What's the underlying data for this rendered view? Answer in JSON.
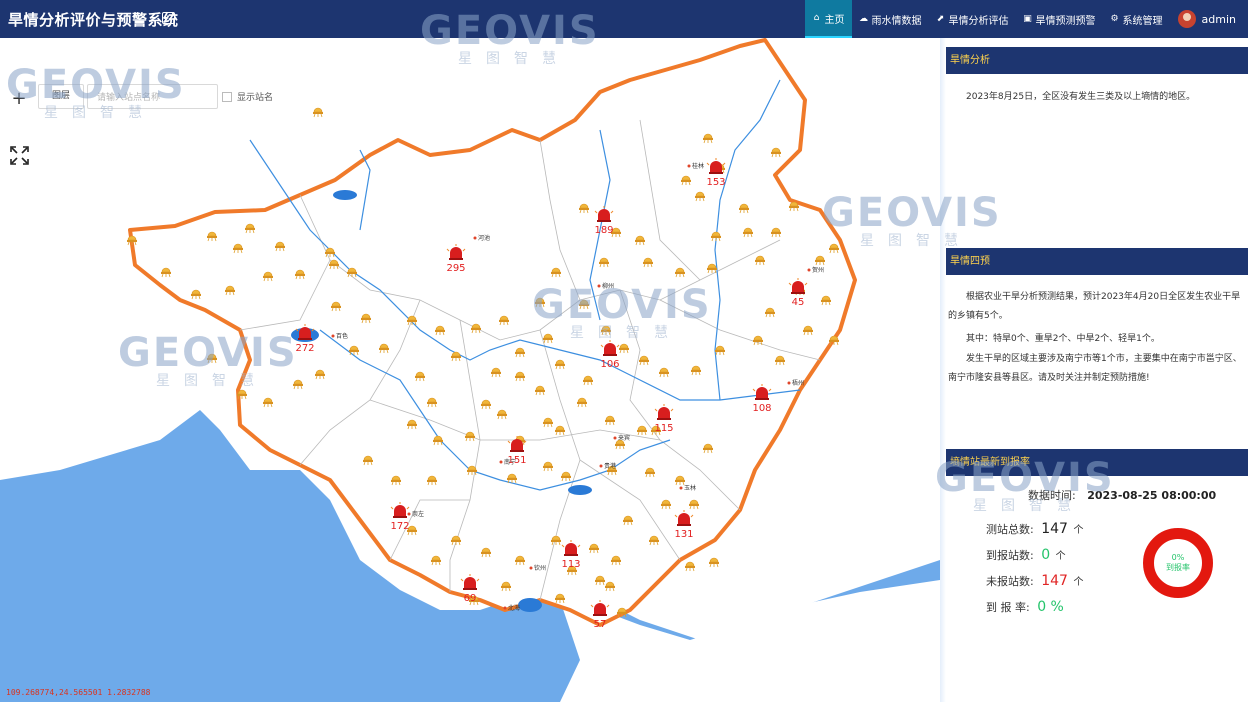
{
  "header": {
    "title": "旱情分析评价与预警系统",
    "nav": [
      {
        "label": "主页",
        "icon": "home-icon",
        "glyph": "⌂",
        "active": true
      },
      {
        "label": "雨水情数据",
        "icon": "rain-cloud-icon",
        "glyph": "☁",
        "active": false
      },
      {
        "label": "旱情分析评估",
        "icon": "chart-icon",
        "glyph": "⬈",
        "active": false
      },
      {
        "label": "旱情预测预警",
        "icon": "monitor-icon",
        "glyph": "▣",
        "active": false
      },
      {
        "label": "系统管理",
        "icon": "gear-icon",
        "glyph": "⚙",
        "active": false
      }
    ],
    "user": "admin"
  },
  "map": {
    "layer_button": "图层",
    "search_placeholder": "请输入站点名称",
    "show_station_name_label": "显示站名",
    "coordinates_readout": "109.268774,24.565501 1.2832788",
    "alarms": [
      {
        "value": "153"
      },
      {
        "value": "189"
      },
      {
        "value": "295"
      },
      {
        "value": "45"
      },
      {
        "value": "272"
      },
      {
        "value": "106"
      },
      {
        "value": "108"
      },
      {
        "value": "115"
      },
      {
        "value": "151"
      },
      {
        "value": "172"
      },
      {
        "value": "131"
      },
      {
        "value": "113"
      },
      {
        "value": "69"
      },
      {
        "value": "57"
      }
    ],
    "city_labels": [
      "桂林",
      "河池",
      "贺州",
      "梧州",
      "百色",
      "柳州",
      "来宾",
      "贵港",
      "玉林",
      "南宁",
      "崇左",
      "钦州",
      "北海"
    ],
    "watermark": {
      "brand": "GEOVIS",
      "tagline": "星图智慧"
    }
  },
  "panel": {
    "drought_analysis": {
      "title": "旱情分析",
      "text": "2023年8月25日，全区没有发生三类及以上墒情的地区。"
    },
    "drought_forecast": {
      "title": "旱情四预",
      "p1": "根据农业干旱分析预测结果，预计2023年4月20日全区发生农业干旱的乡镇有5个。",
      "p2": "其中：特旱0个、重旱2个、中旱2个、轻旱1个。",
      "p3": "发生干旱的区域主要涉及南宁市等1个市，主要集中在南宁市邕宁区、南宁市隆安县等县区。请及时关注并制定预防措施!"
    },
    "report": {
      "title": "墒情站最新到报率",
      "time_label": "数据时间:",
      "time_value": "2023-08-25 08:00:00",
      "total_label": "测站总数:",
      "total_value": "147",
      "reported_label": "到报站数:",
      "reported_value": "0",
      "unreported_label": "未报站数:",
      "unreported_value": "147",
      "rate_label": "到 报 率:",
      "rate_value": "0 %",
      "ring_value": "0%",
      "ring_label": "到报率",
      "unit": "个",
      "rate_fraction": 0
    }
  }
}
